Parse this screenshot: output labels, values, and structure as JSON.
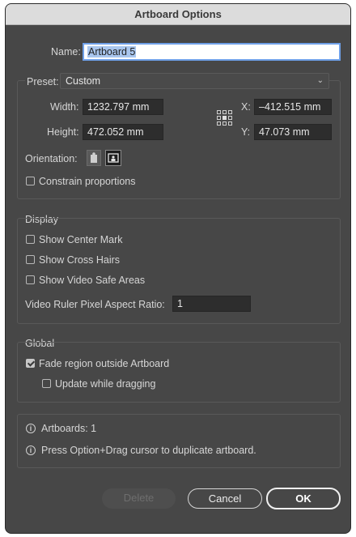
{
  "title": "Artboard Options",
  "name": {
    "label": "Name:",
    "value": "Artboard 5"
  },
  "preset": {
    "label": "Preset:",
    "value": "Custom"
  },
  "width": {
    "label": "Width:",
    "value": "1232.797 mm"
  },
  "height": {
    "label": "Height:",
    "value": "472.052 mm"
  },
  "x": {
    "label": "X:",
    "value": "–412.515 mm"
  },
  "y": {
    "label": "Y:",
    "value": "47.073 mm"
  },
  "orientation": {
    "label": "Orientation:",
    "selected": "landscape"
  },
  "constrain": {
    "label": "Constrain proportions",
    "checked": false
  },
  "display": {
    "heading": "Display",
    "show_center_mark": {
      "label": "Show Center Mark",
      "checked": false
    },
    "show_cross_hairs": {
      "label": "Show Cross Hairs",
      "checked": false
    },
    "show_video_safe": {
      "label": "Show Video Safe Areas",
      "checked": false
    },
    "pixel_ratio": {
      "label": "Video Ruler Pixel Aspect Ratio:",
      "value": "1"
    }
  },
  "global": {
    "heading": "Global",
    "fade_region": {
      "label": "Fade region outside Artboard",
      "checked": true
    },
    "update_dragging": {
      "label": "Update while dragging",
      "checked": false
    }
  },
  "info": {
    "artboards": "Artboards: 1",
    "tip": "Press Option+Drag cursor to duplicate artboard."
  },
  "buttons": {
    "delete": "Delete",
    "cancel": "Cancel",
    "ok": "OK"
  },
  "colors": {
    "dialog_bg": "#474747",
    "field_bg": "#2d2d2d",
    "focus": "#6fa0e8"
  }
}
